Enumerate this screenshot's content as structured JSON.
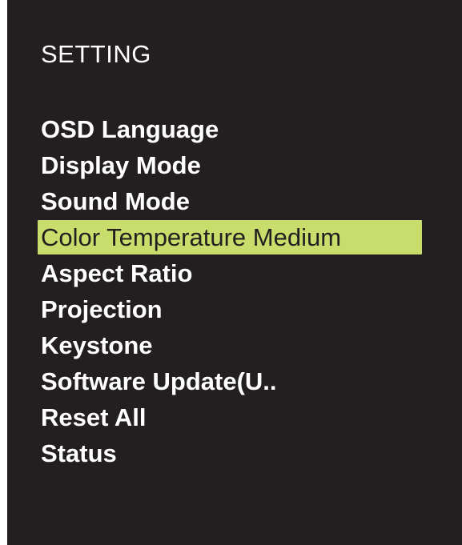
{
  "colors": {
    "background": "#231f20",
    "text": "#ffffff",
    "highlight": "#c9dd6c",
    "highlight_text": "#231f20"
  },
  "menu": {
    "title": "SETTING",
    "items": [
      {
        "label": "OSD Language",
        "selected": false
      },
      {
        "label": "Display Mode",
        "selected": false
      },
      {
        "label": "Sound Mode",
        "selected": false
      },
      {
        "label": "Color Temperature Medium",
        "selected": true
      },
      {
        "label": "Aspect Ratio",
        "selected": false
      },
      {
        "label": "Projection",
        "selected": false
      },
      {
        "label": "Keystone",
        "selected": false
      },
      {
        "label": "Software Update(U..",
        "selected": false
      },
      {
        "label": "Reset All",
        "selected": false
      },
      {
        "label": "Status",
        "selected": false
      }
    ]
  }
}
